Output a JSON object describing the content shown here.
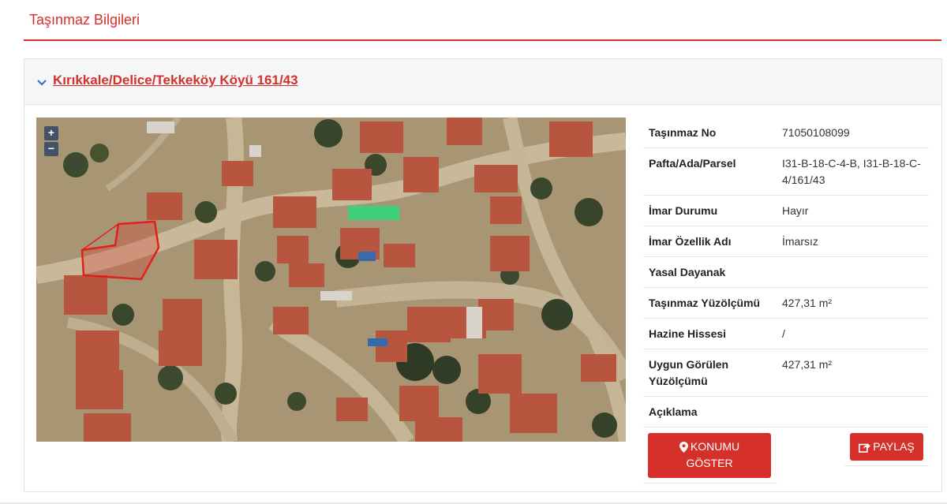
{
  "header": {
    "title": "Taşınmaz Bilgileri"
  },
  "panel": {
    "location_link": "Kırıkkale/Delice/Tekkeköy Köyü 161/43"
  },
  "map": {
    "zoom_in": "+",
    "zoom_out": "−"
  },
  "info": {
    "rows": [
      {
        "label": "Taşınmaz No",
        "value": "71050108099"
      },
      {
        "label": "Pafta/Ada/Parsel",
        "value": "I31-B-18-C-4-B, I31-B-18-C-4/161/43"
      },
      {
        "label": "İmar Durumu",
        "value": "Hayır"
      },
      {
        "label": "İmar Özellik Adı",
        "value": "İmarsız"
      },
      {
        "label": "Yasal Dayanak",
        "value": ""
      },
      {
        "label": "Taşınmaz Yüzölçümü",
        "value": "427,31 m²"
      },
      {
        "label": "Hazine Hissesi",
        "value": "/"
      },
      {
        "label": "Uygun Görülen Yüzölçümü",
        "value": "427,31 m²"
      },
      {
        "label": "Açıklama",
        "value": ""
      }
    ]
  },
  "buttons": {
    "konum_line1": "KONUMU",
    "konum_line2": "GÖSTER",
    "paylas": "PAYLAŞ"
  },
  "colors": {
    "accent": "#d6302a",
    "parcel_outline": "#e0201a"
  },
  "icons": {
    "konum": "map-marker-icon",
    "paylas": "share-icon",
    "toggle": "chevron-down-icon"
  }
}
